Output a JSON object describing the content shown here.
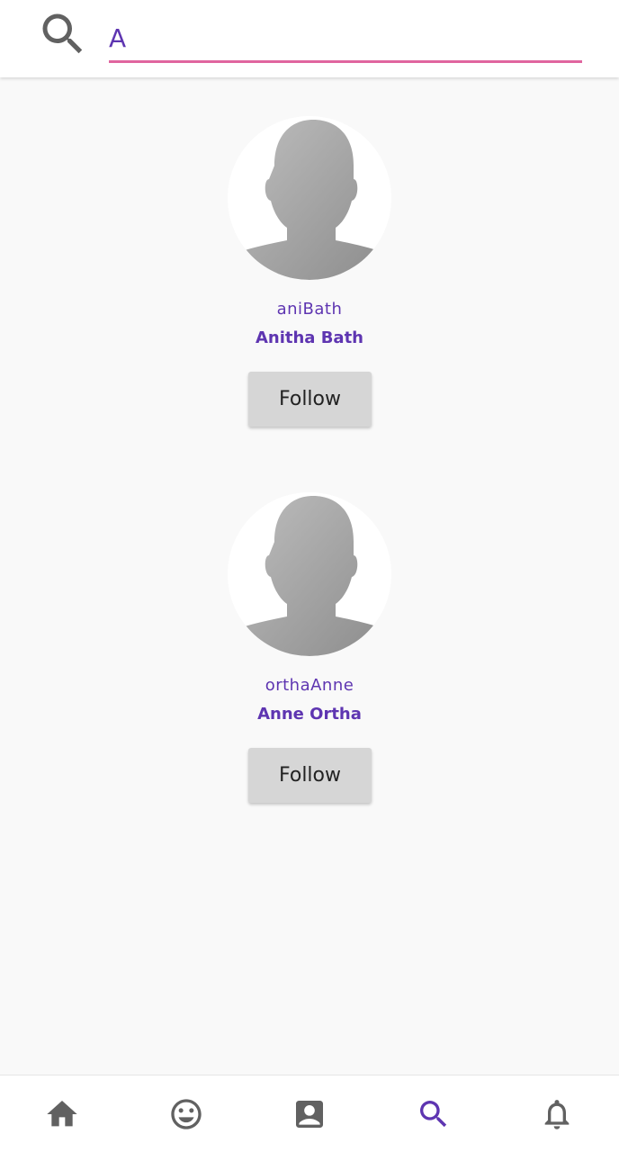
{
  "search": {
    "value": "A",
    "icon": "search-icon",
    "underline_color": "#e0659f",
    "text_color": "#5e35b1"
  },
  "results": [
    {
      "username": "aniBath",
      "full_name": "Anitha Bath",
      "follow_label": "Follow",
      "avatar_icon": "default-avatar-icon"
    },
    {
      "username": "orthaAnne",
      "full_name": "Anne Ortha",
      "follow_label": "Follow",
      "avatar_icon": "default-avatar-icon"
    }
  ],
  "bottom_nav": {
    "items": [
      {
        "icon": "home-icon",
        "active": false
      },
      {
        "icon": "smiley-icon",
        "active": false
      },
      {
        "icon": "contact-card-icon",
        "active": false
      },
      {
        "icon": "search-icon",
        "active": true
      },
      {
        "icon": "bell-icon",
        "active": false
      }
    ],
    "active_color": "#5e35b1",
    "inactive_color": "#616161"
  }
}
